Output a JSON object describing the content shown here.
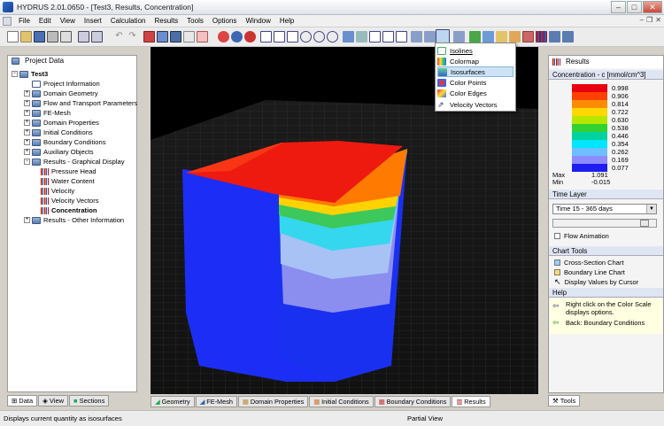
{
  "window": {
    "title": "HYDRUS 2.01.0650 - [Test3, Results, Concentration]"
  },
  "menu": [
    "File",
    "Edit",
    "View",
    "Insert",
    "Calculation",
    "Results",
    "Tools",
    "Options",
    "Window",
    "Help"
  ],
  "left_panel": {
    "title": "Project Data",
    "root": "Test3",
    "items": [
      "Project Information",
      "Domain Geometry",
      "Flow and Transport Parameters",
      "FE-Mesh",
      "Domain Properties",
      "Initial Conditions",
      "Boundary Conditions",
      "Auxiliary Objects",
      "Results - Graphical Display",
      "Pressure Head",
      "Water Content",
      "Velocity",
      "Velocity Vectors",
      "Concentration",
      "Results - Other Information"
    ],
    "tabs": [
      "Data",
      "View",
      "Sections"
    ]
  },
  "dropdown_menu": [
    "Isolines",
    "Colormap",
    "Isosurfaces",
    "Color Points",
    "Color Edges",
    "Velocity Vectors"
  ],
  "bottom_tabs": [
    "Geometry",
    "FE-Mesh",
    "Domain Properties",
    "Initial Conditions",
    "Boundary Conditions",
    "Results"
  ],
  "right_panel": {
    "title": "Results",
    "legend_title": "Concentration - c [mmol/cm^3]",
    "legend": [
      {
        "value": "0.998",
        "color": "#e8000e"
      },
      {
        "value": "0.906",
        "color": "#ff4000"
      },
      {
        "value": "0.814",
        "color": "#ff8c00"
      },
      {
        "value": "0.722",
        "color": "#ffd800"
      },
      {
        "value": "0.630",
        "color": "#b8e600"
      },
      {
        "value": "0.538",
        "color": "#32d232"
      },
      {
        "value": "0.446",
        "color": "#00d2a0"
      },
      {
        "value": "0.354",
        "color": "#00e6ff"
      },
      {
        "value": "0.262",
        "color": "#6ebeff"
      },
      {
        "value": "0.169",
        "color": "#8c8cff"
      },
      {
        "value": "0.077",
        "color": "#1e1ef0"
      }
    ],
    "max_label": "Max",
    "max_value": "1.091",
    "min_label": "Min",
    "min_value": "-0.015",
    "time_layer_title": "Time Layer",
    "time_layer_value": "Time 15 - 365 days",
    "flow_animation": "Flow Animation",
    "chart_tools_title": "Chart Tools",
    "chart_tools": [
      "Cross-Section Chart",
      "Boundary Line Chart",
      "Display Values by Cursor"
    ],
    "help_title": "Help",
    "help_text1": "Right click on the Color Scale displays options.",
    "help_text2": "Back: Boundary Conditions",
    "tools_tab": "Tools"
  },
  "status": {
    "left": "Displays current quantity as isosurfaces",
    "center": "Partial View"
  }
}
